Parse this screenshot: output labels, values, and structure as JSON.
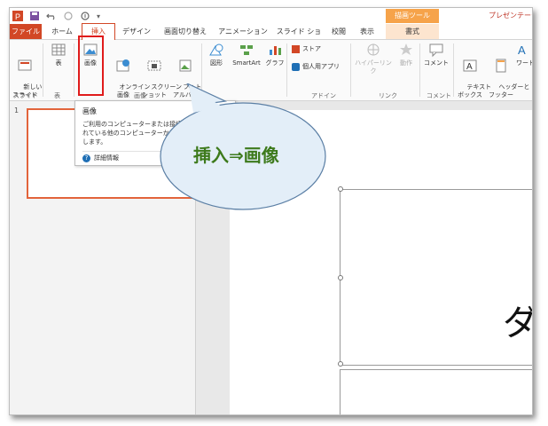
{
  "qat": {
    "icons": [
      "powerpoint-logo-icon",
      "save-icon",
      "undo-icon",
      "redo-icon",
      "touch-mode-icon",
      "customize-qat-icon"
    ]
  },
  "contextual": {
    "group_label": "描画ツール",
    "doc_title": "プレゼンテーシ"
  },
  "tabs": [
    "ファイル",
    "ホーム",
    "挿入",
    "デザイン",
    "画面切り替え",
    "アニメーション",
    "スライド ショー",
    "校閲",
    "表示",
    "書式"
  ],
  "ribbon": {
    "new_slide": "新しい\nスライド",
    "table": "表",
    "image": "画像",
    "online_image": "オンライン\n画像",
    "screenshot": "スクリーン\nショット",
    "photo_album": "フォト\nアルバム",
    "shapes": "図形",
    "smartart": "SmartArt",
    "chart": "グラフ",
    "store": "ストア",
    "personal_apps": "個人用アプリ",
    "hyperlink": "ハイパーリンク",
    "action": "動作",
    "comment": "コメント",
    "textbox": "テキスト\nボックス",
    "header_footer": "ヘッダーと\nフッター",
    "wordart": "ワード",
    "groups": {
      "slides": "スライド",
      "tables": "表",
      "images": "画像",
      "apps": "アドイン",
      "links": "リンク",
      "comments": "コメント"
    }
  },
  "tooltip": {
    "title": "画像",
    "body": "ご利用のコンピューターまたは接続されている他のコンピューターから挿入します。",
    "link": "詳細情報"
  },
  "slides": {
    "thumb_number": "1",
    "partial_text": "ダ"
  },
  "callout": {
    "text": "挿入⇒画像",
    "fill": "#e3eef8",
    "stroke": "#5b7fa5",
    "text_color": "#3d7a1c"
  },
  "colors": {
    "accent": "#d24726",
    "highlight": "#e01b1b",
    "thumb_border": "#e2643b"
  }
}
